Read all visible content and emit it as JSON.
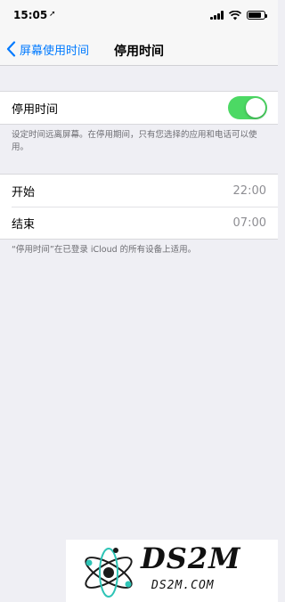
{
  "status_bar": {
    "time": "15:05",
    "location_glyph": "➚",
    "icons": [
      "signal-icon",
      "wifi-icon",
      "battery-icon"
    ],
    "battery_level": 0.8
  },
  "nav": {
    "back_label": "屏幕使用时间",
    "title": "停用时间"
  },
  "downtime": {
    "label": "停用时间",
    "enabled": true,
    "note": "设定时间远离屏幕。在停用期间，只有您选择的应用和电话可以使用。"
  },
  "schedule": {
    "start_label": "开始",
    "start_value": "22:00",
    "end_label": "结束",
    "end_value": "07:00",
    "note": "“停用时间”在已登录 iCloud 的所有设备上适用。"
  },
  "watermark": {
    "title": "DS2M",
    "subtitle": "DS2M.COM"
  },
  "colors": {
    "accent": "#007aff",
    "toggle_on": "#4cd964",
    "background": "#efeff4"
  }
}
